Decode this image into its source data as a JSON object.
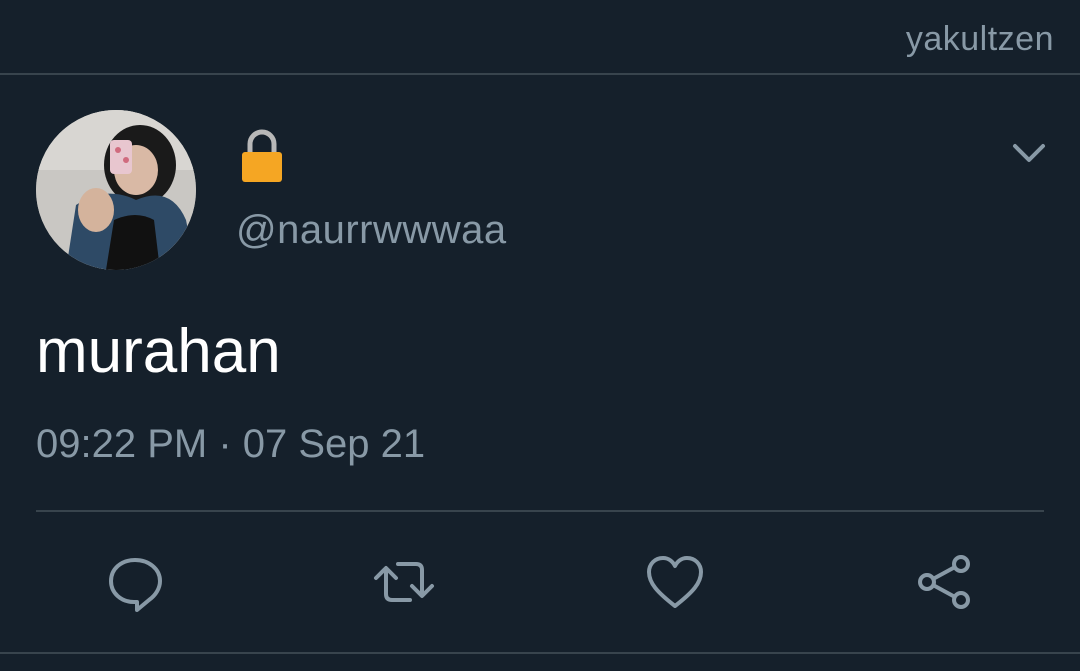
{
  "header": {
    "username": "yakultzen"
  },
  "tweet": {
    "avatar_icon": "profile-photo",
    "lock_icon": "lock-icon",
    "handle": "@naurrwwwaa",
    "text": "murahan",
    "timestamp": "09:22 PM · 07 Sep 21",
    "menu_icon": "chevron-down-icon"
  },
  "actions": [
    {
      "icon": "reply-icon"
    },
    {
      "icon": "retweet-icon"
    },
    {
      "icon": "like-icon"
    },
    {
      "icon": "share-icon"
    }
  ],
  "colors": {
    "background": "#15202b",
    "secondary_text": "#8899a6",
    "divider": "#38444d",
    "primary_text": "#ffffff",
    "lock": "#f5a623"
  }
}
